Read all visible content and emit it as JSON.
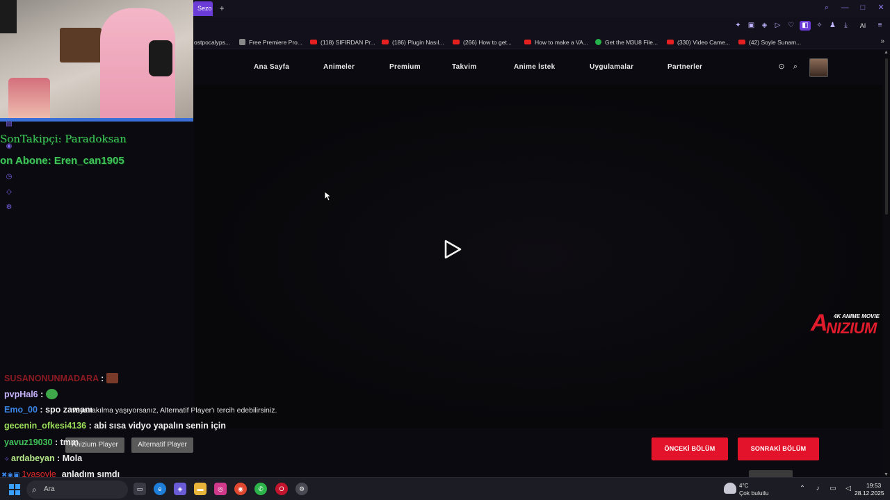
{
  "browser": {
    "active_tab_label": "Sezo",
    "new_tab_label": "+",
    "ai_label": "AI",
    "bookmarks": [
      {
        "label": "ostpocalyps...",
        "icon": "none"
      },
      {
        "label": "Free Premiere Pro...",
        "icon": "page-icon"
      },
      {
        "label": "(118) SIFIRDAN Pr...",
        "icon": "youtube-icon"
      },
      {
        "label": "(186) Plugin Nasıl...",
        "icon": "youtube-icon"
      },
      {
        "label": "(266) How to get...",
        "icon": "youtube-icon"
      },
      {
        "label": "How to make a VA...",
        "icon": "youtube-icon"
      },
      {
        "label": "Get the M3U8 File...",
        "icon": "green-circle-icon"
      },
      {
        "label": "(330) Video Came...",
        "icon": "youtube-icon"
      },
      {
        "label": "(42) Soyle Sunam...",
        "icon": "youtube-icon"
      }
    ]
  },
  "site": {
    "nav": [
      {
        "label": "Ana Sayfa"
      },
      {
        "label": "Animeler"
      },
      {
        "label": "Premium"
      },
      {
        "label": "Takvim"
      },
      {
        "label": "Anime İstek"
      },
      {
        "label": "Uygulamalar"
      },
      {
        "label": "Partnerler"
      }
    ],
    "brand_tagline": "4K ANIME MOVIE",
    "brand_name": "NIZIUM",
    "brand_letter": "A",
    "player_note": "veya takılma yaşıyorsanız, Alternatif Player'ı tercih edebilirsiniz.",
    "player_chip_1": "Anizium Player",
    "player_chip_2": "Alternatif Player",
    "prev_episode": "ÖNCEKİ BÖLÜM",
    "next_episode": "SONRAKİ BÖLÜM"
  },
  "stream": {
    "last_follower": "SonTakipçi: Paradoksan",
    "last_sub": "on Abone: Eren_can1905",
    "chat": [
      {
        "user": "SUSANONUNMADARA",
        "sep": " :",
        "message": "",
        "color": "#8b1a22",
        "emote": "#7a3a2a"
      },
      {
        "user": "pvpHal6",
        "sep": " :",
        "message": "",
        "color": "#c8b4ff",
        "emote": "#3fa84a"
      },
      {
        "user": "Emo_00",
        "sep": " :",
        "message": " spo zamanı",
        "color": "#3a86e8",
        "emote": ""
      },
      {
        "user": "gecenin_ofkesi4136",
        "sep": " :",
        "message": " abi sısa vidyo yapalın senin için",
        "color": "#9ce05a",
        "emote": ""
      },
      {
        "user": "yavuz19030",
        "sep": " :",
        "message": " tmm",
        "color": "#40c45a",
        "emote": ""
      },
      {
        "user": "ardabeyan",
        "sep": " :",
        "message": " Mola",
        "color": "#b4e88a",
        "emote": ""
      },
      {
        "user": "1yasoyle",
        "sep": "",
        "message": "anladım şımdı",
        "color": "#e02a2a",
        "emote": ""
      }
    ]
  },
  "taskbar": {
    "search_placeholder": "Ara",
    "weather_temp": "4°C",
    "weather_desc": "Çok bulutlu",
    "time": "19:53",
    "date": "28.12.2025"
  },
  "colors": {
    "accent_purple": "#6a3bd6",
    "episode_red": "#e2132a",
    "overlay_green": "#40c45a"
  }
}
